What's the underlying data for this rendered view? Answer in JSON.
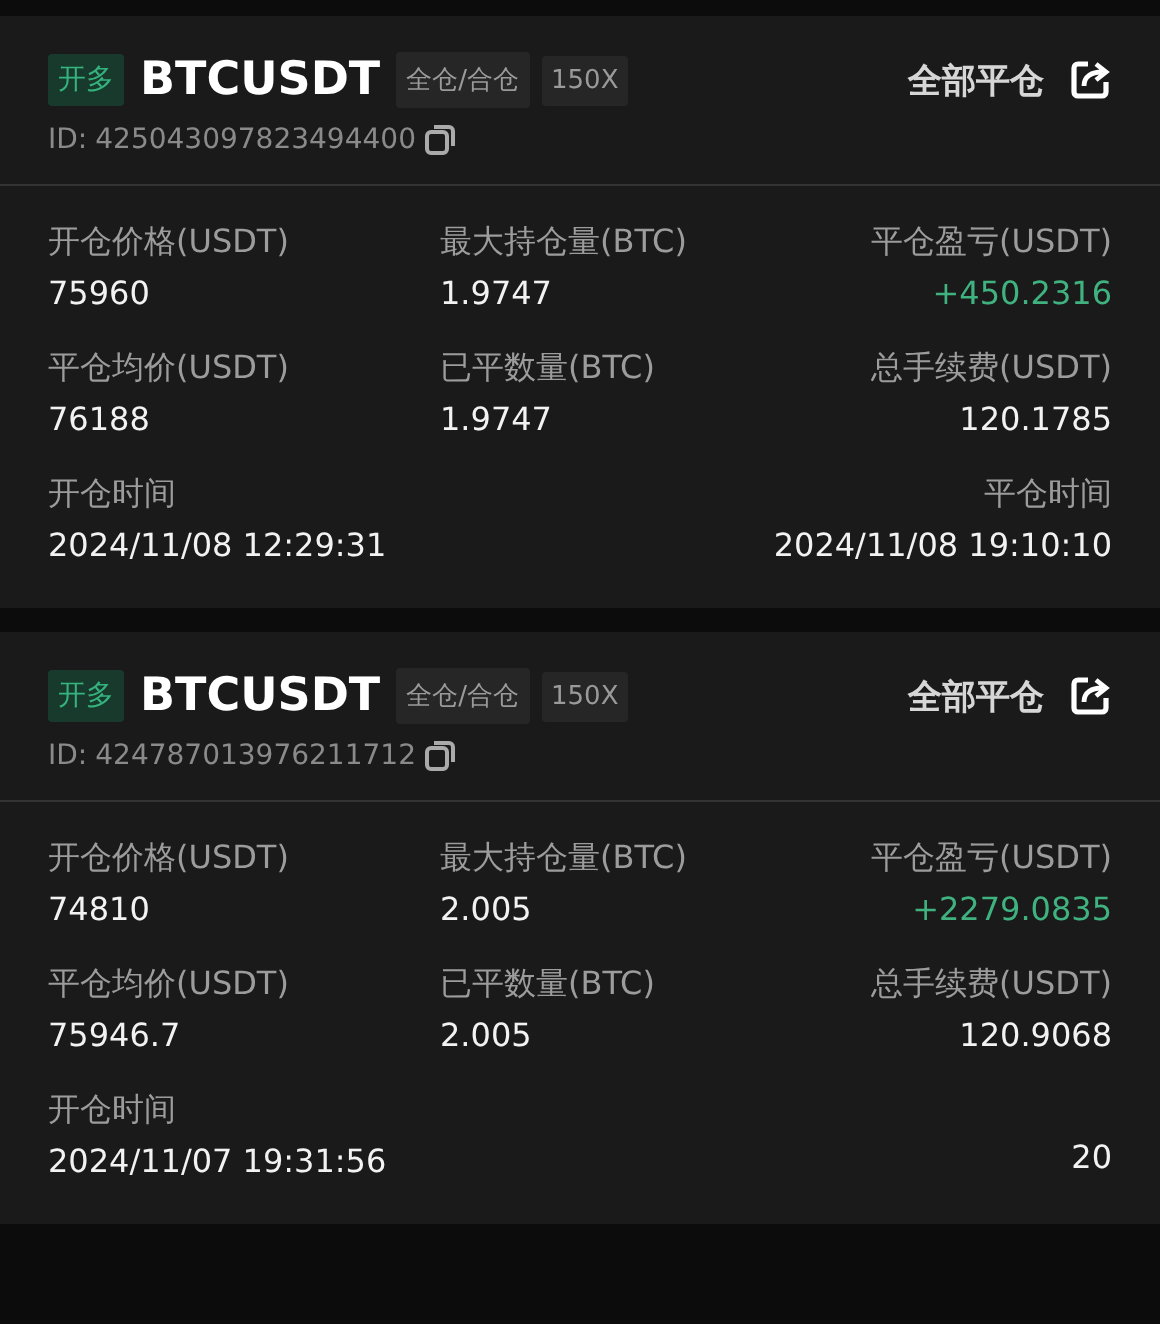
{
  "cards": [
    {
      "side": "开多",
      "symbol": "BTCUSDT",
      "margin_mode": "全仓/合仓",
      "leverage": "150X",
      "close_all": "全部平仓",
      "id_label": "ID:",
      "id": "425043097823494400",
      "rows": [
        [
          {
            "kind": "plain",
            "label": "开仓价格(USDT)",
            "value": "75960"
          },
          {
            "kind": "plain",
            "label": "最大持仓量(BTC)",
            "value": "1.9747"
          },
          {
            "kind": "profit",
            "label": "平仓盈亏(USDT)",
            "value": "+450.2316"
          }
        ],
        [
          {
            "kind": "plain",
            "label": "平仓均价(USDT)",
            "value": "76188"
          },
          {
            "kind": "plain",
            "label": "已平数量(BTC)",
            "value": "1.9747"
          },
          {
            "kind": "plain",
            "label": "总手续费(USDT)",
            "value": "120.1785"
          }
        ],
        [
          {
            "kind": "plain",
            "label": "开仓时间",
            "value": "2024/11/08 12:29:31"
          },
          "",
          {
            "kind": "plain",
            "label": "平仓时间",
            "value": "2024/11/08 19:10:10"
          }
        ]
      ]
    },
    {
      "side": "开多",
      "symbol": "BTCUSDT",
      "margin_mode": "全仓/合仓",
      "leverage": "150X",
      "close_all": "全部平仓",
      "id_label": "ID:",
      "id": "424787013976211712",
      "rows": [
        [
          {
            "kind": "plain",
            "label": "开仓价格(USDT)",
            "value": "74810"
          },
          {
            "kind": "plain",
            "label": "最大持仓量(BTC)",
            "value": "2.005"
          },
          {
            "kind": "profit",
            "label": "平仓盈亏(USDT)",
            "value": "+2279.0835"
          }
        ],
        [
          {
            "kind": "plain",
            "label": "平仓均价(USDT)",
            "value": "75946.7"
          },
          {
            "kind": "plain",
            "label": "已平数量(BTC)",
            "value": "2.005"
          },
          {
            "kind": "plain",
            "label": "总手续费(USDT)",
            "value": "120.9068"
          }
        ],
        [
          {
            "kind": "plain",
            "label": "开仓时间",
            "value": "2024/11/07 19:31:56"
          },
          "",
          {
            "kind": "plain",
            "value": "20"
          }
        ]
      ]
    }
  ]
}
